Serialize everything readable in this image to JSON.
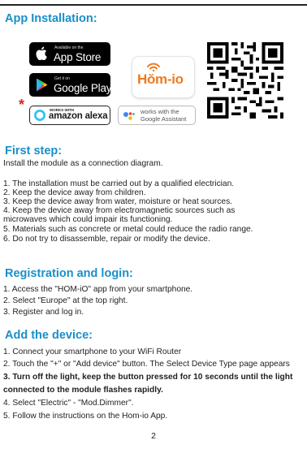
{
  "header": {
    "title": "App Installation:"
  },
  "stores": {
    "appstore_small": "Available on the",
    "appstore_big": "App Store",
    "googleplay_small": "Get it on",
    "googleplay_big": "Google Play",
    "alexa_small": "WORKS WITH",
    "alexa_big": "amazon alexa",
    "assistant_line1": "works with the",
    "assistant_line2": "Google Assistant",
    "homio_logo": "Hŏm-io"
  },
  "asterisk": "*",
  "first_step": {
    "title": "First step:",
    "intro": "Install the module as a connection diagram.",
    "items": [
      "1. The installation must be carried out by a qualified electrician.",
      "2. Keep the device away from children.",
      "3. Keep the device away from water, moisture or heat sources.",
      "4. Keep the device away from electromagnetic sources such as",
      "microwaves which could impair its functioning.",
      "5. Materials such as concrete or metal could reduce the radio range.",
      "6. Do not try to disassemble, repair or modify the device."
    ]
  },
  "registration": {
    "title": "Registration and login:",
    "items": [
      "1. Access the \"HOM-iO\" app from your smartphone.",
      "2. Select \"Europe\" at the top right.",
      "3. Register and log in."
    ]
  },
  "add_device": {
    "title": "Add the device:",
    "items": [
      "1. Connect your smartphone to your WiFi Router",
      "2. Touch the \"+\" or \"Add device\" button. The Select Device Type page appears",
      "3. Turn off the light, keep the button pressed for 10 seconds until the light",
      "connected to the module flashes rapidly.",
      "4. Select \"Electric\" - \"Mod.Dimmer\".",
      "5. Follow the instructions on the Hom-io App."
    ]
  },
  "page_number": "2",
  "colors": {
    "heading": "#1a8fc9",
    "homio_orange": "#f07a1e",
    "asterisk": "#e02020"
  }
}
